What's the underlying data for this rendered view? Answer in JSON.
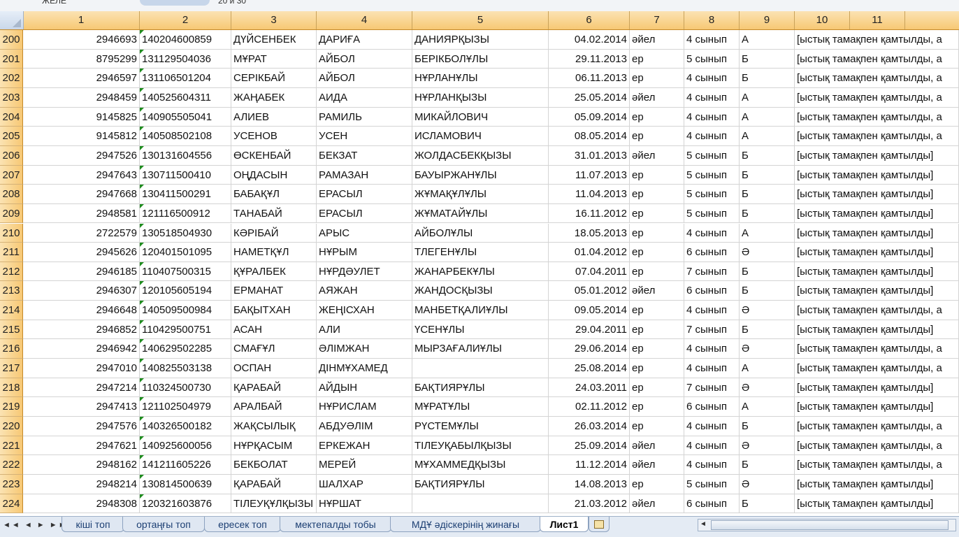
{
  "formula_bar": {
    "name_box": "ЖЕЛЕ",
    "value": "20 и 30"
  },
  "columns": [
    "1",
    "2",
    "3",
    "4",
    "5",
    "6",
    "7",
    "8",
    "9",
    "10",
    "11"
  ],
  "rows": [
    {
      "n": "200",
      "c": [
        "2946693",
        "140204600859",
        "ДҮЙСЕНБЕК",
        "ДАРИҒА",
        "ДАНИЯРҚЫЗЫ",
        "04.02.2014",
        "әйел",
        "4 сынып",
        "А",
        "[ыстық тамақпен қамтылды, а"
      ]
    },
    {
      "n": "201",
      "c": [
        "8795299",
        "131129504036",
        "МҰРАТ",
        "АЙБОЛ",
        "БЕРІКБОЛҰЛЫ",
        "29.11.2013",
        "ер",
        "5 сынып",
        "Б",
        "[ыстық тамақпен қамтылды, а"
      ]
    },
    {
      "n": "202",
      "c": [
        "2946597",
        "131106501204",
        "СЕРІКБАЙ",
        "АЙБОЛ",
        "НҰРЛАНҰЛЫ",
        "06.11.2013",
        "ер",
        "4 сынып",
        "Б",
        "[ыстық тамақпен қамтылды, а"
      ]
    },
    {
      "n": "203",
      "c": [
        "2948459",
        "140525604311",
        "ЖАҢАБЕК",
        "АИДА",
        "НҰРЛАНҚЫЗЫ",
        "25.05.2014",
        "әйел",
        "4 сынып",
        "А",
        "[ыстық тамақпен қамтылды, а"
      ]
    },
    {
      "n": "204",
      "c": [
        "9145825",
        "140905505041",
        "АЛИЕВ",
        "РАМИЛЬ",
        "МИКАЙЛОВИЧ",
        "05.09.2014",
        "ер",
        "4 сынып",
        "А",
        "[ыстық тамақпен қамтылды, а"
      ]
    },
    {
      "n": "205",
      "c": [
        "9145812",
        "140508502108",
        "УСЕНОВ",
        "УСЕН",
        "ИСЛАМОВИЧ",
        "08.05.2014",
        "ер",
        "4 сынып",
        "А",
        "[ыстық тамақпен қамтылды, а"
      ]
    },
    {
      "n": "206",
      "c": [
        "2947526",
        "130131604556",
        "ӨСКЕНБАЙ",
        "БЕКЗАТ",
        "ЖОЛДАСБЕКҚЫЗЫ",
        "31.01.2013",
        "әйел",
        "5 сынып",
        "Б",
        "[ыстық тамақпен қамтылды]"
      ]
    },
    {
      "n": "207",
      "c": [
        "2947643",
        "130711500410",
        "ОҢДАСЫН",
        "РАМАЗАН",
        "БАУЫРЖАНҰЛЫ",
        "11.07.2013",
        "ер",
        "5 сынып",
        "Б",
        "[ыстық тамақпен қамтылды]"
      ]
    },
    {
      "n": "208",
      "c": [
        "2947668",
        "130411500291",
        "БАБАҚҰЛ",
        "ЕРАСЫЛ",
        "ЖҰМАҚҰЛҰЛЫ",
        "11.04.2013",
        "ер",
        "5 сынып",
        "Б",
        "[ыстық тамақпен қамтылды]"
      ]
    },
    {
      "n": "209",
      "c": [
        "2948581",
        "121116500912",
        "ТАНАБАЙ",
        "ЕРАСЫЛ",
        "ЖҰМАТАЙҰЛЫ",
        "16.11.2012",
        "ер",
        "5 сынып",
        "Б",
        "[ыстық тамақпен қамтылды]"
      ]
    },
    {
      "n": "210",
      "c": [
        "2722579",
        "130518504930",
        "КӘРІБАЙ",
        "АРЫС",
        "АЙБОЛҰЛЫ",
        "18.05.2013",
        "ер",
        "4 сынып",
        "А",
        "[ыстық тамақпен қамтылды]"
      ]
    },
    {
      "n": "211",
      "c": [
        "2945626",
        "120401501095",
        "НАМЕТҚҰЛ",
        "НҰРЫМ",
        "ТЛЕГЕНҰЛЫ",
        "01.04.2012",
        "ер",
        "6 сынып",
        "Ә",
        "[ыстық тамақпен қамтылды]"
      ]
    },
    {
      "n": "212",
      "c": [
        "2946185",
        "110407500315",
        "ҚҰРАЛБЕК",
        "НҰРДӘУЛЕТ",
        "ЖАНАРБЕКҰЛЫ",
        "07.04.2011",
        "ер",
        "7 сынып",
        "Б",
        "[ыстық тамақпен қамтылды]"
      ]
    },
    {
      "n": "213",
      "c": [
        "2946307",
        "120105605194",
        "ЕРМАНАТ",
        "АЯЖАН",
        "ЖАНДОСҚЫЗЫ",
        "05.01.2012",
        "әйел",
        "6 сынып",
        "Б",
        "[ыстық тамақпен қамтылды]"
      ]
    },
    {
      "n": "214",
      "c": [
        "2946648",
        "140509500984",
        "БАҚЫТХАН",
        "ЖЕҢІСХАН",
        "МАНБЕТҚАЛИҰЛЫ",
        "09.05.2014",
        "ер",
        "4 сынып",
        "Ә",
        "[ыстық тамақпен қамтылды, а"
      ]
    },
    {
      "n": "215",
      "c": [
        "2946852",
        "110429500751",
        "АСАН",
        "АЛИ",
        "ҮСЕНҰЛЫ",
        "29.04.2011",
        "ер",
        "7 сынып",
        "Б",
        "[ыстық тамақпен қамтылды]"
      ]
    },
    {
      "n": "216",
      "c": [
        "2946942",
        "140629502285",
        "СМАҒҰЛ",
        "ӘЛІМЖАН",
        "МЫРЗАҒАЛИҰЛЫ",
        "29.06.2014",
        "ер",
        "4 сынып",
        "Ә",
        "[ыстық тамақпен қамтылды, а"
      ]
    },
    {
      "n": "217",
      "c": [
        "2947010",
        "140825503138",
        "ОСПАН",
        "ДІНМҰХАМЕД",
        "",
        "25.08.2014",
        "ер",
        "4 сынып",
        "А",
        "[ыстық тамақпен қамтылды, а"
      ]
    },
    {
      "n": "218",
      "c": [
        "2947214",
        "110324500730",
        "ҚАРАБАЙ",
        "АЙДЫН",
        "БАҚТИЯРҰЛЫ",
        "24.03.2011",
        "ер",
        "7 сынып",
        "Ә",
        "[ыстық тамақпен қамтылды]"
      ]
    },
    {
      "n": "219",
      "c": [
        "2947413",
        "121102504979",
        "АРАЛБАЙ",
        "НҰРИСЛАМ",
        "МҰРАТҰЛЫ",
        "02.11.2012",
        "ер",
        "6 сынып",
        "А",
        "[ыстық тамақпен қамтылды]"
      ]
    },
    {
      "n": "220",
      "c": [
        "2947576",
        "140326500182",
        "ЖАҚСЫЛЫҚ",
        "АБДУӘЛІМ",
        "РҮСТЕМҰЛЫ",
        "26.03.2014",
        "ер",
        "4 сынып",
        "Б",
        "[ыстық тамақпен қамтылды, а"
      ]
    },
    {
      "n": "221",
      "c": [
        "2947621",
        "140925600056",
        "НҰРҚАСЫМ",
        "ЕРКЕЖАН",
        "ТІЛЕУҚАБЫЛҚЫЗЫ",
        "25.09.2014",
        "әйел",
        "4 сынып",
        "Ә",
        "[ыстық тамақпен қамтылды, а"
      ]
    },
    {
      "n": "222",
      "c": [
        "2948162",
        "141211605226",
        "БЕКБОЛАТ",
        "МЕРЕЙ",
        "МҰХАММЕДҚЫЗЫ",
        "11.12.2014",
        "әйел",
        "4 сынып",
        "Б",
        "[ыстық тамақпен қамтылды, а"
      ]
    },
    {
      "n": "223",
      "c": [
        "2948214",
        "130814500639",
        "ҚАРАБАЙ",
        "ШАЛХАР",
        "БАҚТИЯРҰЛЫ",
        "14.08.2013",
        "ер",
        "5 сынып",
        "Ә",
        "[ыстық тамақпен қамтылды]"
      ]
    },
    {
      "n": "224",
      "c": [
        "2948308",
        "120321603876",
        "ТІЛЕУҚҰЛҚЫЗЫ",
        "НҰРШАТ",
        "",
        "21.03.2012",
        "әйел",
        "6 сынып",
        "Б",
        "[ыстық тамақпен қамтылды]"
      ]
    }
  ],
  "sheet_tabs": [
    "кіші топ",
    "ортаңғы топ",
    "ересек топ",
    "мектепалды тобы",
    "МДҰ әдіскерінің жинағы",
    "Лист1"
  ],
  "active_sheet": "Лист1",
  "nav_glyphs": "◄◄ ◄ ► ►►",
  "colors": {
    "header": "#f7c874",
    "grid": "#d4d4d4",
    "text_marker": "#1e8c1e"
  }
}
